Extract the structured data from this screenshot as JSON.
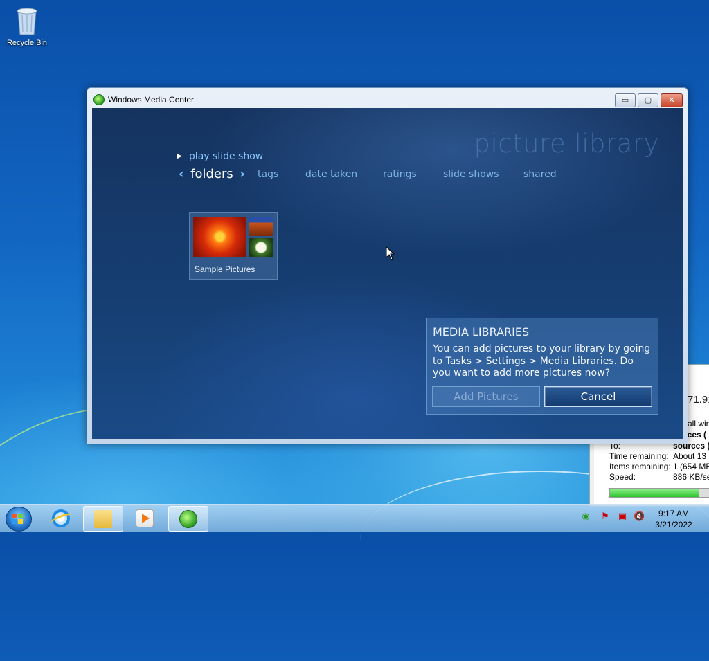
{
  "desktop": {
    "icons": [
      {
        "label": "Recycle Bin",
        "icon": "recycle-bin-icon"
      }
    ]
  },
  "copy_window": {
    "big_text": "71.91",
    "partial_name": "all.win",
    "sources_label_1": "rces (",
    "to_label": "To:",
    "sources_label_2": "sources (",
    "rows": [
      {
        "key": "Time remaining:",
        "value": "About 13"
      },
      {
        "key": "Items remaining:",
        "value": "1 (654 MB"
      },
      {
        "key": "Speed:",
        "value": "886 KB/se"
      }
    ],
    "progress": 0.85
  },
  "media_center": {
    "window_title": "Windows Media Center",
    "window_controls": {
      "minimize": "▭",
      "maximize": "▢",
      "close": "✕"
    },
    "library_title": "picture library",
    "play_slide_show": "play slide show",
    "pivots": [
      {
        "label": "folders",
        "active": true
      },
      {
        "label": "tags"
      },
      {
        "label": "date taken"
      },
      {
        "label": "ratings"
      },
      {
        "label": "slide shows"
      },
      {
        "label": "shared"
      }
    ],
    "pivot_prev": "‹",
    "pivot_next": "›",
    "tile": {
      "caption": "Sample Pictures"
    },
    "dialog": {
      "title": "MEDIA LIBRARIES",
      "message": "You can add pictures to your library by going to Tasks > Settings > Media Libraries. Do you want to add more pictures now?",
      "add_button": "Add Pictures",
      "cancel_button": "Cancel"
    }
  },
  "taskbar": {
    "clock_time": "9:17 AM",
    "clock_date": "3/21/2022",
    "buttons": [
      "internet-explorer-icon",
      "file-explorer-icon",
      "media-player-icon",
      "media-center-icon"
    ],
    "tray_icons": [
      "network-icon",
      "action-center-icon",
      "network-disconnected-icon",
      "volume-muted-icon"
    ]
  },
  "colors": {
    "wmc_background": "#163f74",
    "accent_text": "#7fb6e8",
    "desktop": "#1266c2"
  }
}
